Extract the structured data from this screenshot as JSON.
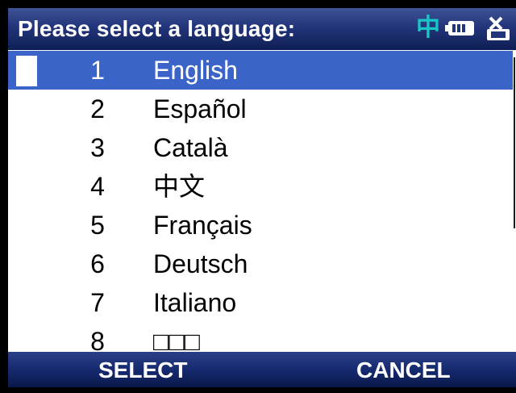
{
  "title": "Please select a language:",
  "status": {
    "ime_char": "中"
  },
  "languages": [
    {
      "num": "1",
      "label": "English",
      "selected": true
    },
    {
      "num": "2",
      "label": "Español"
    },
    {
      "num": "3",
      "label": "Català"
    },
    {
      "num": "4",
      "label": "中文"
    },
    {
      "num": "5",
      "label": "Français"
    },
    {
      "num": "6",
      "label": "Deutsch"
    },
    {
      "num": "7",
      "label": "Italiano"
    },
    {
      "num": "8",
      "label": "□□□"
    }
  ],
  "softkeys": {
    "left": "SELECT",
    "right": "CANCEL"
  },
  "colors": {
    "titlebar": "#23357a",
    "selection": "#3a64c8",
    "ime_indicator": "#18c6c6",
    "softkey_bar": "#162a70"
  }
}
